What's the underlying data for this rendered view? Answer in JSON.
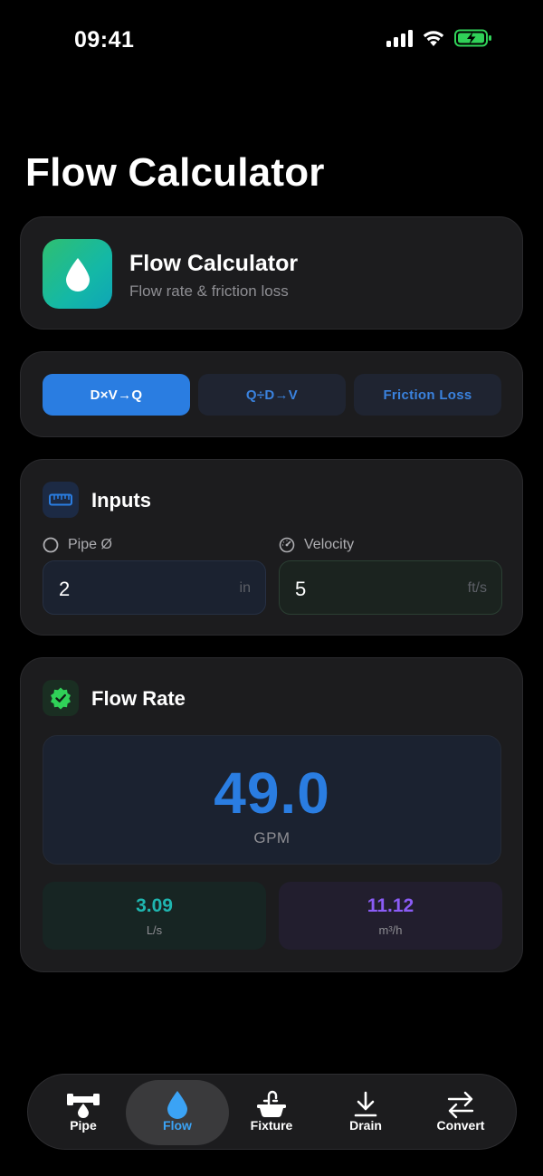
{
  "status": {
    "time": "09:41"
  },
  "page": {
    "title": "Flow Calculator"
  },
  "header": {
    "title": "Flow Calculator",
    "subtitle": "Flow rate & friction loss"
  },
  "modes": [
    {
      "label": "D×V→Q",
      "active": true
    },
    {
      "label": "Q÷D→V",
      "active": false
    },
    {
      "label": "Friction Loss",
      "active": false
    }
  ],
  "inputs": {
    "title": "Inputs",
    "pipe": {
      "label": "Pipe Ø",
      "value": "2",
      "unit": "in"
    },
    "velocity": {
      "label": "Velocity",
      "value": "5",
      "unit": "ft/s"
    }
  },
  "result": {
    "title": "Flow Rate",
    "main": {
      "value": "49.0",
      "unit": "GPM"
    },
    "secondary": [
      {
        "value": "3.09",
        "unit": "L/s",
        "color": "#1fb6b0"
      },
      {
        "value": "11.12",
        "unit": "m³/h",
        "color": "#8b5cf6"
      }
    ]
  },
  "tabs": [
    {
      "label": "Pipe",
      "icon": "pipe-icon",
      "active": false
    },
    {
      "label": "Flow",
      "icon": "drop-icon",
      "active": true
    },
    {
      "label": "Fixture",
      "icon": "sink-icon",
      "active": false
    },
    {
      "label": "Drain",
      "icon": "drain-icon",
      "active": false
    },
    {
      "label": "Convert",
      "icon": "convert-icon",
      "active": false
    }
  ],
  "colors": {
    "accent": "#2a7de1",
    "teal": "#1fb6b0",
    "purple": "#8b5cf6",
    "green": "#30d158",
    "tab_active": "#3ba3f5"
  }
}
